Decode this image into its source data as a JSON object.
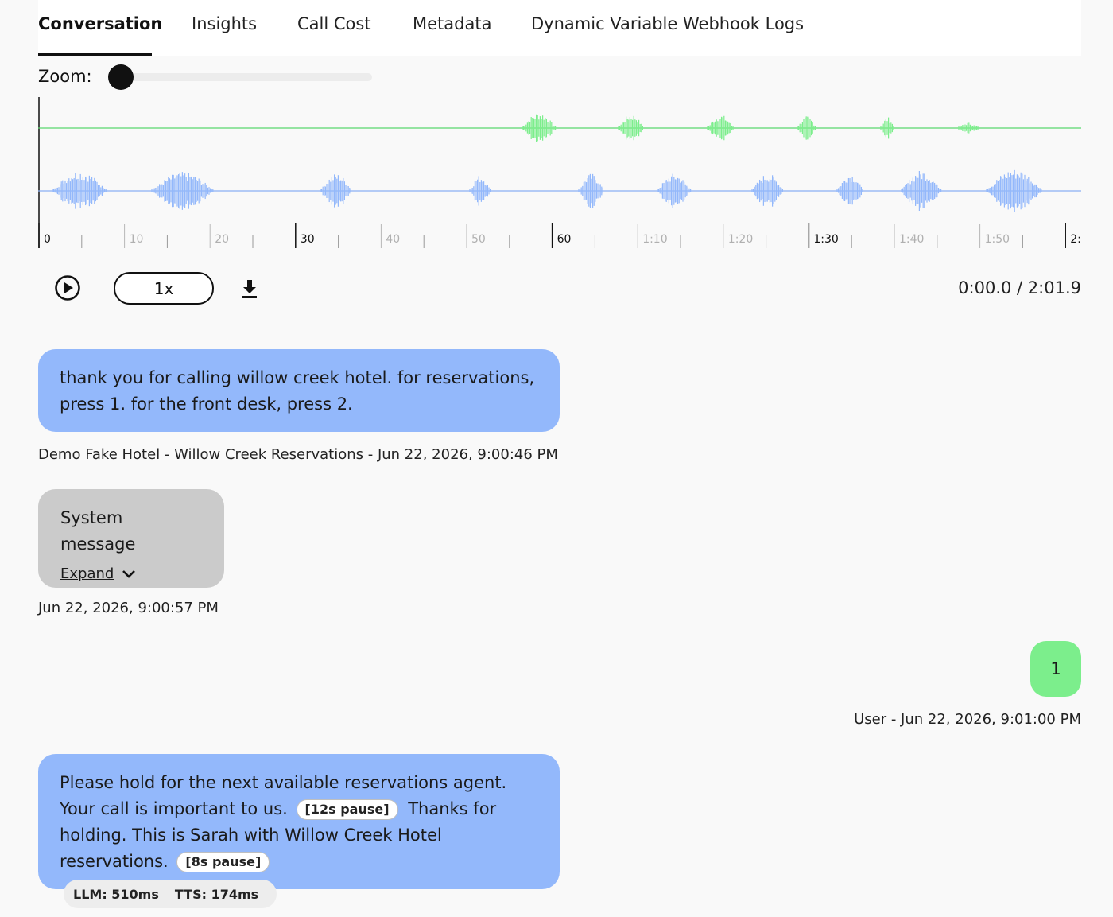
{
  "tabs": [
    {
      "label": "Conversation",
      "active": true
    },
    {
      "label": "Insights",
      "active": false
    },
    {
      "label": "Call Cost",
      "active": false
    },
    {
      "label": "Metadata",
      "active": false
    },
    {
      "label": "Dynamic Variable Webhook Logs",
      "active": false
    }
  ],
  "zoom": {
    "label": "Zoom:",
    "level": 0
  },
  "timeline": {
    "ticks": [
      "0",
      "10",
      "20",
      "30",
      "40",
      "50",
      "60",
      "1:10",
      "1:20",
      "1:30",
      "1:40",
      "1:50",
      "2:"
    ],
    "major_ticks": [
      "0",
      "30",
      "60",
      "1:30",
      "2:"
    ],
    "track_colors": {
      "user": "#7cee8c",
      "agent": "#93b8fb"
    }
  },
  "player": {
    "speed_label": "1x",
    "time_readout": "0:00.0 / 2:01.9"
  },
  "icons": {
    "play": "play-circle-icon",
    "download": "download-icon",
    "expand": "chevron-down-icon"
  },
  "messages": {
    "m1": {
      "text": "thank you for calling willow creek hotel. for reservations, press 1. for the front desk, press 2.",
      "meta": "Demo Fake Hotel - Willow Creek Reservations  -  Jun 22, 2026, 9:00:46 PM"
    },
    "m2": {
      "title": "System message",
      "expand_label": "Expand",
      "meta": "Jun 22, 2026, 9:00:57 PM"
    },
    "m3": {
      "text": "1",
      "meta": "User  -  Jun 22, 2026, 9:01:00 PM"
    },
    "m4": {
      "part1": "Please hold for the next available reservations agent. Your call is important to us.",
      "pause1": "[12s pause]",
      "part2": "Thanks for holding. This is Sarah with Willow Creek Hotel reservations.",
      "pause2": "[8s pause]",
      "llm": "LLM: 510ms",
      "tts": "TTS: 174ms"
    }
  }
}
